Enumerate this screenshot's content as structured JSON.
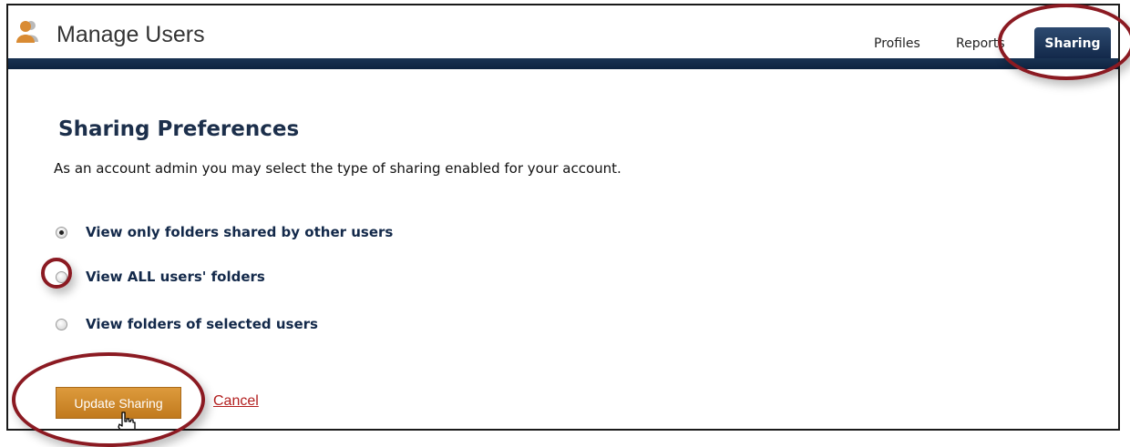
{
  "header": {
    "title": "Manage Users",
    "tabs": [
      {
        "label": "Profiles",
        "active": false
      },
      {
        "label": "Reports",
        "active": false
      },
      {
        "label": "Sharing",
        "active": true
      }
    ],
    "logo_icon": "users-icon",
    "bar_color": "#13294a"
  },
  "main": {
    "section_title": "Sharing Preferences",
    "description": "As an account admin you may select the type of sharing enabled for your account.",
    "options": [
      {
        "label": "View only folders shared by other users",
        "checked": true
      },
      {
        "label": "View ALL users' folders",
        "checked": false
      },
      {
        "label": "View folders of selected users",
        "checked": false
      }
    ],
    "update_button": "Update Sharing",
    "cancel_link": "Cancel"
  },
  "annotations": {
    "highlight_color": "#8b1a22",
    "pointer_icon": "hand-pointer-icon"
  },
  "colors": {
    "accent_button": "#d08a2c",
    "link": "#b21e1e",
    "heading": "#1c2f4b"
  }
}
